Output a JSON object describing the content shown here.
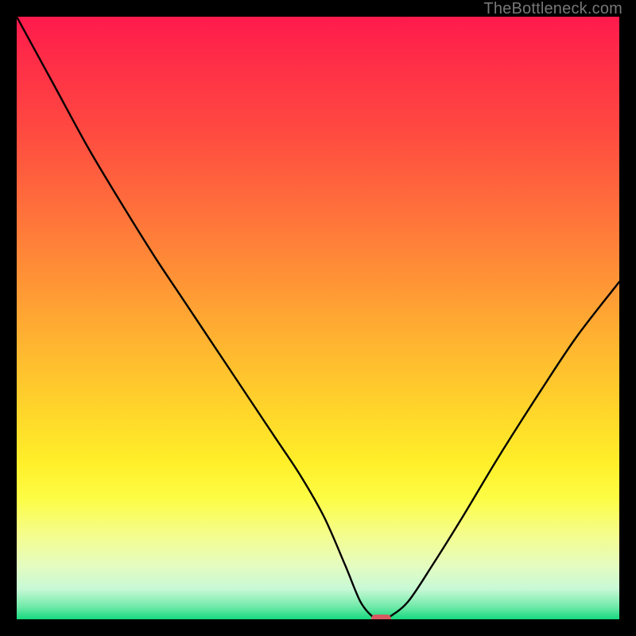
{
  "watermark": "TheBottleneck.com",
  "chart_data": {
    "type": "line",
    "title": "",
    "xlabel": "",
    "ylabel": "",
    "xlim": [
      0,
      100
    ],
    "ylim": [
      0,
      100
    ],
    "series": [
      {
        "name": "bottleneck-curve",
        "x": [
          0,
          6,
          12,
          18,
          23,
          27,
          31,
          35,
          39,
          43,
          47,
          51,
          54.5,
          57,
          59,
          60.5,
          62,
          65,
          69,
          74,
          80,
          87,
          93,
          100
        ],
        "y": [
          100,
          89,
          78,
          68,
          60,
          54,
          48,
          42,
          36,
          30,
          24,
          17,
          9,
          3,
          0.5,
          0,
          0.5,
          3,
          9,
          17,
          27,
          38,
          47,
          56
        ]
      }
    ],
    "marker": {
      "x": 60.5,
      "y": 0,
      "width_pct": 3.3,
      "height_pct": 1.35,
      "color": "#d65a5f"
    },
    "gradient_stops": [
      {
        "pct": 0,
        "color": "#ff1a4d"
      },
      {
        "pct": 8,
        "color": "#ff2f47"
      },
      {
        "pct": 18,
        "color": "#ff4741"
      },
      {
        "pct": 30,
        "color": "#ff6a3c"
      },
      {
        "pct": 42,
        "color": "#ff8e36"
      },
      {
        "pct": 55,
        "color": "#ffb730"
      },
      {
        "pct": 66,
        "color": "#ffd72a"
      },
      {
        "pct": 74,
        "color": "#ffef29"
      },
      {
        "pct": 80,
        "color": "#fdfd45"
      },
      {
        "pct": 86,
        "color": "#f4fd8d"
      },
      {
        "pct": 91,
        "color": "#e5fcbf"
      },
      {
        "pct": 95,
        "color": "#c7f9d6"
      },
      {
        "pct": 98,
        "color": "#6de9a7"
      },
      {
        "pct": 100,
        "color": "#15d87d"
      }
    ]
  }
}
